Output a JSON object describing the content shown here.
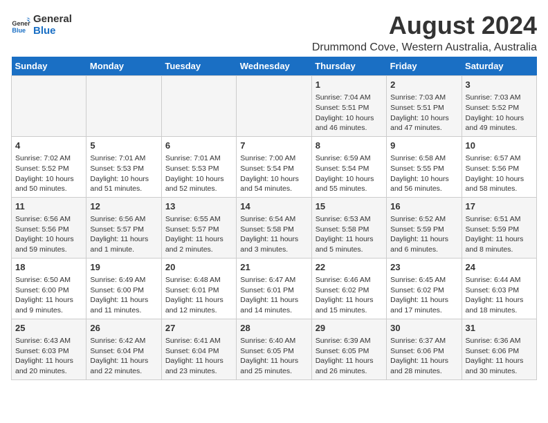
{
  "logo": {
    "line1": "General",
    "line2": "Blue"
  },
  "title": "August 2024",
  "subtitle": "Drummond Cove, Western Australia, Australia",
  "days_of_week": [
    "Sunday",
    "Monday",
    "Tuesday",
    "Wednesday",
    "Thursday",
    "Friday",
    "Saturday"
  ],
  "weeks": [
    [
      {
        "day": "",
        "content": ""
      },
      {
        "day": "",
        "content": ""
      },
      {
        "day": "",
        "content": ""
      },
      {
        "day": "",
        "content": ""
      },
      {
        "day": "1",
        "content": "Sunrise: 7:04 AM\nSunset: 5:51 PM\nDaylight: 10 hours\nand 46 minutes."
      },
      {
        "day": "2",
        "content": "Sunrise: 7:03 AM\nSunset: 5:51 PM\nDaylight: 10 hours\nand 47 minutes."
      },
      {
        "day": "3",
        "content": "Sunrise: 7:03 AM\nSunset: 5:52 PM\nDaylight: 10 hours\nand 49 minutes."
      }
    ],
    [
      {
        "day": "4",
        "content": "Sunrise: 7:02 AM\nSunset: 5:52 PM\nDaylight: 10 hours\nand 50 minutes."
      },
      {
        "day": "5",
        "content": "Sunrise: 7:01 AM\nSunset: 5:53 PM\nDaylight: 10 hours\nand 51 minutes."
      },
      {
        "day": "6",
        "content": "Sunrise: 7:01 AM\nSunset: 5:53 PM\nDaylight: 10 hours\nand 52 minutes."
      },
      {
        "day": "7",
        "content": "Sunrise: 7:00 AM\nSunset: 5:54 PM\nDaylight: 10 hours\nand 54 minutes."
      },
      {
        "day": "8",
        "content": "Sunrise: 6:59 AM\nSunset: 5:54 PM\nDaylight: 10 hours\nand 55 minutes."
      },
      {
        "day": "9",
        "content": "Sunrise: 6:58 AM\nSunset: 5:55 PM\nDaylight: 10 hours\nand 56 minutes."
      },
      {
        "day": "10",
        "content": "Sunrise: 6:57 AM\nSunset: 5:56 PM\nDaylight: 10 hours\nand 58 minutes."
      }
    ],
    [
      {
        "day": "11",
        "content": "Sunrise: 6:56 AM\nSunset: 5:56 PM\nDaylight: 10 hours\nand 59 minutes."
      },
      {
        "day": "12",
        "content": "Sunrise: 6:56 AM\nSunset: 5:57 PM\nDaylight: 11 hours\nand 1 minute."
      },
      {
        "day": "13",
        "content": "Sunrise: 6:55 AM\nSunset: 5:57 PM\nDaylight: 11 hours\nand 2 minutes."
      },
      {
        "day": "14",
        "content": "Sunrise: 6:54 AM\nSunset: 5:58 PM\nDaylight: 11 hours\nand 3 minutes."
      },
      {
        "day": "15",
        "content": "Sunrise: 6:53 AM\nSunset: 5:58 PM\nDaylight: 11 hours\nand 5 minutes."
      },
      {
        "day": "16",
        "content": "Sunrise: 6:52 AM\nSunset: 5:59 PM\nDaylight: 11 hours\nand 6 minutes."
      },
      {
        "day": "17",
        "content": "Sunrise: 6:51 AM\nSunset: 5:59 PM\nDaylight: 11 hours\nand 8 minutes."
      }
    ],
    [
      {
        "day": "18",
        "content": "Sunrise: 6:50 AM\nSunset: 6:00 PM\nDaylight: 11 hours\nand 9 minutes."
      },
      {
        "day": "19",
        "content": "Sunrise: 6:49 AM\nSunset: 6:00 PM\nDaylight: 11 hours\nand 11 minutes."
      },
      {
        "day": "20",
        "content": "Sunrise: 6:48 AM\nSunset: 6:01 PM\nDaylight: 11 hours\nand 12 minutes."
      },
      {
        "day": "21",
        "content": "Sunrise: 6:47 AM\nSunset: 6:01 PM\nDaylight: 11 hours\nand 14 minutes."
      },
      {
        "day": "22",
        "content": "Sunrise: 6:46 AM\nSunset: 6:02 PM\nDaylight: 11 hours\nand 15 minutes."
      },
      {
        "day": "23",
        "content": "Sunrise: 6:45 AM\nSunset: 6:02 PM\nDaylight: 11 hours\nand 17 minutes."
      },
      {
        "day": "24",
        "content": "Sunrise: 6:44 AM\nSunset: 6:03 PM\nDaylight: 11 hours\nand 18 minutes."
      }
    ],
    [
      {
        "day": "25",
        "content": "Sunrise: 6:43 AM\nSunset: 6:03 PM\nDaylight: 11 hours\nand 20 minutes."
      },
      {
        "day": "26",
        "content": "Sunrise: 6:42 AM\nSunset: 6:04 PM\nDaylight: 11 hours\nand 22 minutes."
      },
      {
        "day": "27",
        "content": "Sunrise: 6:41 AM\nSunset: 6:04 PM\nDaylight: 11 hours\nand 23 minutes."
      },
      {
        "day": "28",
        "content": "Sunrise: 6:40 AM\nSunset: 6:05 PM\nDaylight: 11 hours\nand 25 minutes."
      },
      {
        "day": "29",
        "content": "Sunrise: 6:39 AM\nSunset: 6:05 PM\nDaylight: 11 hours\nand 26 minutes."
      },
      {
        "day": "30",
        "content": "Sunrise: 6:37 AM\nSunset: 6:06 PM\nDaylight: 11 hours\nand 28 minutes."
      },
      {
        "day": "31",
        "content": "Sunrise: 6:36 AM\nSunset: 6:06 PM\nDaylight: 11 hours\nand 30 minutes."
      }
    ]
  ]
}
